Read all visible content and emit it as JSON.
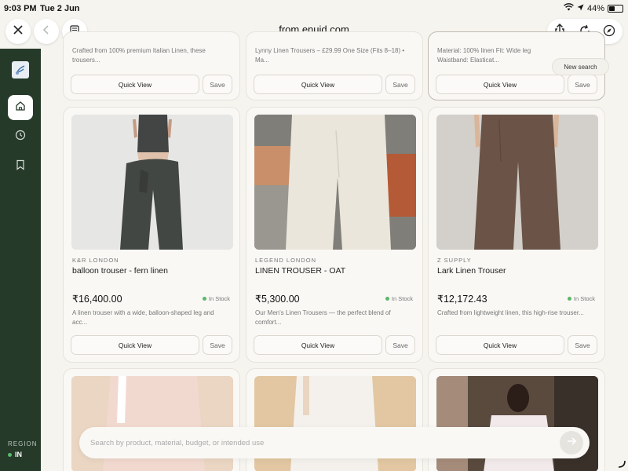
{
  "status": {
    "time": "9:03 PM",
    "date": "Tue 2 Jun",
    "battery": "44%",
    "battery_level": 0.44
  },
  "browser": {
    "url": "from.enuid.com"
  },
  "sidebar": {
    "region_label": "REGION",
    "region_value": "IN"
  },
  "new_search_label": "New search",
  "top_row": [
    {
      "desc": "Crafted from 100% premium Italian Linen, these trousers...",
      "quick_view": "Quick View",
      "save": "Save"
    },
    {
      "desc": "Lynny Linen Trousers – £29.99 One Size (Fits 8–18) • Ma...",
      "quick_view": "Quick View",
      "save": "Save"
    },
    {
      "desc": "Material: 100% linen Fit: Wide leg Waistband: Elasticat...",
      "quick_view": "Quick View",
      "save": "Save"
    }
  ],
  "products": [
    {
      "brand": "K&R LONDON",
      "title": "balloon trouser - fern linen",
      "price": "₹16,400.00",
      "stock": "In Stock",
      "desc": "A linen trouser with a wide, balloon-shaped leg and acc...",
      "quick_view": "Quick View",
      "save": "Save"
    },
    {
      "brand": "LEGEND LONDON",
      "title": "LINEN TROUSER - OAT",
      "price": "₹5,300.00",
      "stock": "In Stock",
      "desc": "Our Men's Linen Trousers — the perfect blend of comfort...",
      "quick_view": "Quick View",
      "save": "Save"
    },
    {
      "brand": "Z SUPPLY",
      "title": "Lark Linen Trouser",
      "price": "₹12,172.43",
      "stock": "In Stock",
      "desc": "Crafted from lightweight linen, this high-rise trouser...",
      "quick_view": "Quick View",
      "save": "Save"
    }
  ],
  "search": {
    "placeholder": "Search by product, material, budget, or intended use",
    "value": ""
  }
}
